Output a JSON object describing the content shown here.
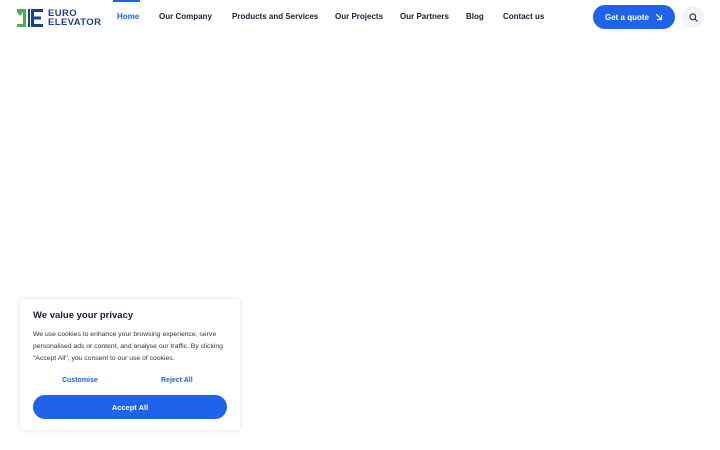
{
  "brand": {
    "line1": "EURO",
    "line2": "ELEVATOR",
    "green": "#4caf50",
    "blue": "#1d3f8f"
  },
  "nav": {
    "items": [
      {
        "label": "Home",
        "active": true
      },
      {
        "label": "Our Company",
        "active": false
      },
      {
        "label": "Products and Services",
        "active": false
      },
      {
        "label": "Our Projects",
        "active": false
      },
      {
        "label": "Our Partners",
        "active": false
      },
      {
        "label": "Blog",
        "active": false
      },
      {
        "label": "Contact us",
        "active": false
      }
    ]
  },
  "header": {
    "quote_label": "Get a quote",
    "quote_icon": "arrow-down-right-icon",
    "search_icon": "search-icon"
  },
  "cookie_banner": {
    "title": "We value your privacy",
    "body": "We use cookies to enhance your browsing experience, serve personalised ads or content, and analyse our traffic. By clicking \"Accept All\", you consent to our use of cookies.",
    "customise_label": "Customise",
    "reject_label": "Reject All",
    "accept_label": "Accept All"
  },
  "colors": {
    "accent": "#1e63e9",
    "text": "#1a1f36",
    "background": "#ffffff"
  }
}
